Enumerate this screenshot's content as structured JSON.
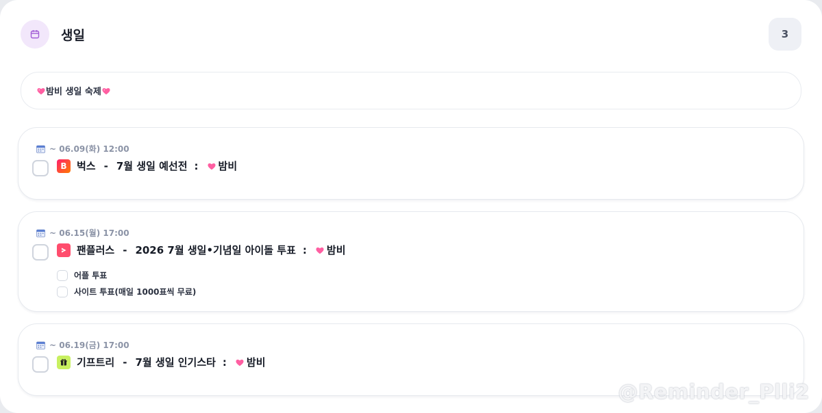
{
  "header": {
    "title": "생일",
    "count": "3",
    "icon": "calendar-icon"
  },
  "banner": {
    "text": "밤비 생일 숙제"
  },
  "tasks": [
    {
      "date": "~ 06.09(화) 12:00",
      "app": "벅스",
      "sep": "-",
      "task": "7월 생일 예선전",
      "colon": ":",
      "target": "밤비",
      "app_color": "#f25a1e"
    },
    {
      "date": "~ 06.15(월) 17:00",
      "app": "팬플러스",
      "sep": "-",
      "task": "2026 7월 생일•기념일 아이돌 투표",
      "colon": ":",
      "target": "밤비",
      "app_color": "#ff4d6d",
      "subtasks": [
        "어플 투표",
        "사이트 투표(매일 1000표씩 무료)"
      ]
    },
    {
      "date": "~ 06.19(금) 17:00",
      "app": "기프트리",
      "sep": "-",
      "task": "7월 생일 인기스타",
      "colon": ":",
      "target": "밤비",
      "app_color": "#c8f060"
    }
  ],
  "watermark": "@Reminder_Plli2"
}
